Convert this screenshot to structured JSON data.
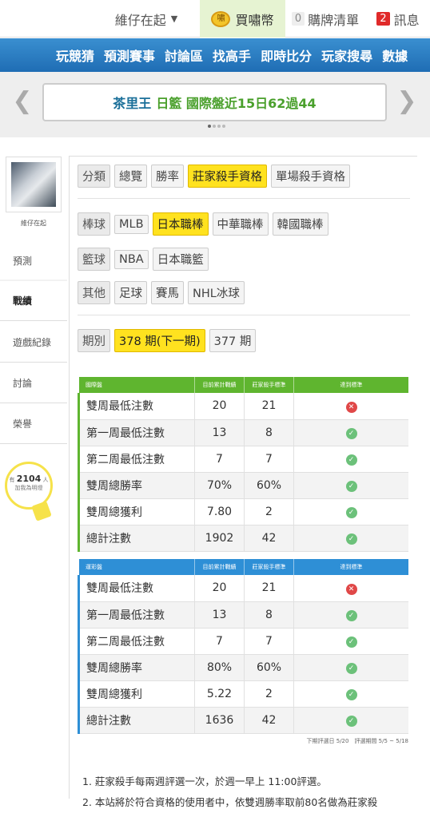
{
  "topbar": {
    "user_label": "維仔在起",
    "coin_icon": "coin-icon",
    "coin_icon_glyph": "嘯",
    "coin_label": "買嘯幣",
    "cart_count": "0",
    "cart_label": "購牌清單",
    "msg_count": "2",
    "msg_label": "訊息"
  },
  "nav": [
    "玩競猜",
    "預測賽事",
    "討論區",
    "找高手",
    "即時比分",
    "玩家搜尋",
    "數據"
  ],
  "banner": {
    "part1": "茶里王",
    "part2": "日籃 國際盤近15日62過44"
  },
  "sidebar": {
    "name": "維仔在起",
    "items": [
      "預測",
      "戰績",
      "遊戲紀錄",
      "討論",
      "榮譽"
    ],
    "active": "戰績",
    "bulb_prefix": "有",
    "bulb_count": "2104",
    "bulb_suffix": "人",
    "bulb_caption": "加我為明燈"
  },
  "filters": {
    "category": {
      "label": "分類",
      "options": [
        "總覽",
        "勝率",
        "莊家殺手資格",
        "單場殺手資格"
      ],
      "selected": "莊家殺手資格"
    },
    "baseball": {
      "label": "棒球",
      "options": [
        "MLB",
        "日本職棒",
        "中華職棒",
        "韓國職棒"
      ],
      "selected": "日本職棒"
    },
    "basketball": {
      "label": "籃球",
      "options": [
        "NBA",
        "日本職籃"
      ],
      "selected": ""
    },
    "other": {
      "label": "其他",
      "options": [
        "足球",
        "賽馬",
        "NHL冰球"
      ],
      "selected": ""
    },
    "period": {
      "label": "期別",
      "options": [
        "378 期(下一期)",
        "377 期"
      ],
      "selected": "378 期(下一期)"
    }
  },
  "tables": [
    {
      "name": "國際盤",
      "headers": [
        "國際盤",
        "目前累計戰績",
        "莊家殺手標準",
        "達到標準"
      ],
      "rows": [
        {
          "item": "雙周最低注數",
          "current": "20",
          "standard": "21",
          "met": false
        },
        {
          "item": "第一周最低注數",
          "current": "13",
          "standard": "8",
          "met": true
        },
        {
          "item": "第二周最低注數",
          "current": "7",
          "standard": "7",
          "met": true
        },
        {
          "item": "雙周總勝率",
          "current": "70%",
          "standard": "60%",
          "met": true
        },
        {
          "item": "雙周總獲利",
          "current": "7.80",
          "standard": "2",
          "met": true
        },
        {
          "item": "總計注數",
          "current": "1902",
          "standard": "42",
          "met": true
        }
      ]
    },
    {
      "name": "運彩盤",
      "headers": [
        "運彩盤",
        "目前累計戰績",
        "莊家殺手標準",
        "達到標準"
      ],
      "rows": [
        {
          "item": "雙周最低注數",
          "current": "20",
          "standard": "21",
          "met": false
        },
        {
          "item": "第一周最低注數",
          "current": "13",
          "standard": "8",
          "met": true
        },
        {
          "item": "第二周最低注數",
          "current": "7",
          "standard": "7",
          "met": true
        },
        {
          "item": "雙周總勝率",
          "current": "80%",
          "standard": "60%",
          "met": true
        },
        {
          "item": "雙周總獲利",
          "current": "5.22",
          "standard": "2",
          "met": true
        },
        {
          "item": "總計注數",
          "current": "1636",
          "standard": "42",
          "met": true
        }
      ]
    }
  ],
  "footnote": "下期評選日 5/20　評選期間 5/5 ~ 5/18",
  "notes": [
    "1. 莊家殺手每兩週評選一次，於週一早上 11:00評選。",
    "2. 本站將於符合資格的使用者中，依雙週勝率取前80名做為莊家殺"
  ],
  "colors": {
    "nav_blue": "#1f6db4",
    "select_yellow": "#ffe21f",
    "green": "#5fb52f",
    "blue": "#2e8fd6",
    "fail_red": "#e04848",
    "ok_green": "#6cc17a"
  }
}
